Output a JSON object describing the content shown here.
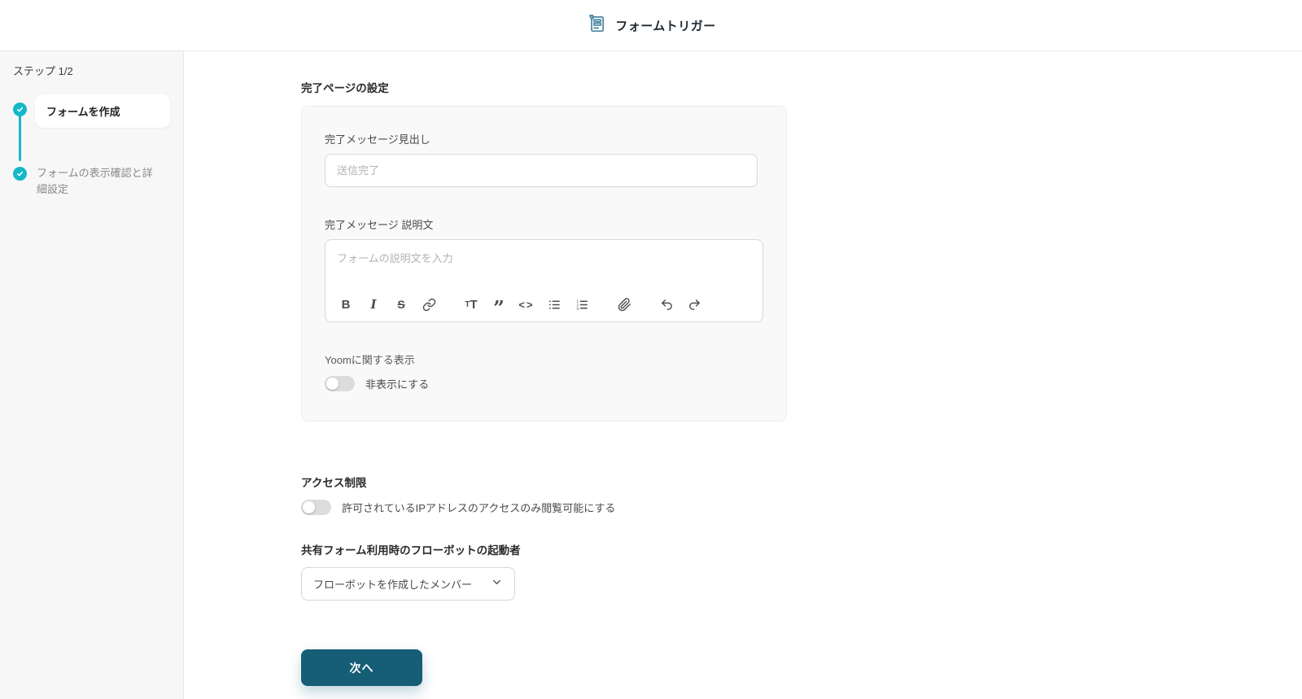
{
  "header": {
    "title": "フォームトリガー",
    "icon": "form-document-icon"
  },
  "sidebar": {
    "step_label": "ステップ 1/2",
    "steps": [
      {
        "label": "フォームを作成",
        "state": "active",
        "icon": "check-icon"
      },
      {
        "label": "フォームの表示確認と詳細設定",
        "state": "upcoming",
        "icon": "check-icon"
      }
    ]
  },
  "main": {
    "section_title": "完了ページの設定",
    "card": {
      "heading_field": {
        "label": "完了メッセージ見出し",
        "value": "",
        "placeholder": "送信完了"
      },
      "description_field": {
        "label": "完了メッセージ 説明文",
        "value": "",
        "placeholder": "フォームの説明文を入力"
      },
      "toolbar": {
        "bold_glyph": "B",
        "italic_glyph": "I",
        "strike_glyph": "S",
        "textsize_small_glyph": "T",
        "textsize_large_glyph": "T",
        "quote_glyph": "”",
        "code_glyph": "<>",
        "icons": [
          "bold-icon",
          "italic-icon",
          "strikethrough-icon",
          "link-icon",
          "text-size-icon",
          "blockquote-icon",
          "code-icon",
          "bullet-list-icon",
          "ordered-list-icon",
          "paperclip-icon",
          "undo-icon",
          "redo-icon"
        ]
      },
      "yoom_display": {
        "label": "Yoomに関する表示",
        "toggle_label": "非表示にする",
        "toggle_on": false
      }
    },
    "access_restriction": {
      "title": "アクセス制限",
      "toggle_label": "許可されているIPアドレスのアクセスのみ閲覧可能にする",
      "toggle_on": false
    },
    "flowbot_launcher": {
      "title": "共有フォーム利用時のフローボットの起動者",
      "selected_option": "フローボットを作成したメンバー"
    },
    "next_button_label": "次へ"
  },
  "colors": {
    "accent_button_teal": "#155e75",
    "step_cyan": "#14b8c9",
    "header_icon_blue": "#4c87a5",
    "sidebar_bg": "#f7f7f8",
    "card_bg": "#f9f9f9",
    "placeholder_gray": "#b3b3b3"
  }
}
